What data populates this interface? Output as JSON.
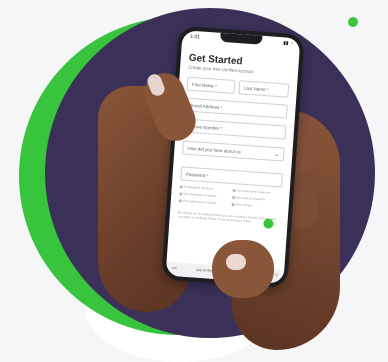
{
  "form": {
    "status_time": "1:01",
    "status_icons": "▮▮ ◔",
    "title": "Get Started",
    "subtitle": "Create your free Verified account",
    "first_name": "First Name *",
    "last_name": "Last Name *",
    "email": "Email Address *",
    "phone": "Phone Number *",
    "heard": "How did you hear about us",
    "password": "Password *",
    "password_rules": [
      "8 characters minimum",
      "100 characters maximum",
      "One lowercase character",
      "One special character",
      "One uppercase character",
      "One number"
    ],
    "terms": "By clicking the Get Started button you are creating a Verified account and you agree to Verified's Terms of Use and Privacy Policy.",
    "browser_aa": "AA",
    "browser_url": "app.verified.com",
    "browser_reload": "↻"
  },
  "colors": {
    "accent_green": "#38c43c",
    "purple": "#3b3158"
  }
}
